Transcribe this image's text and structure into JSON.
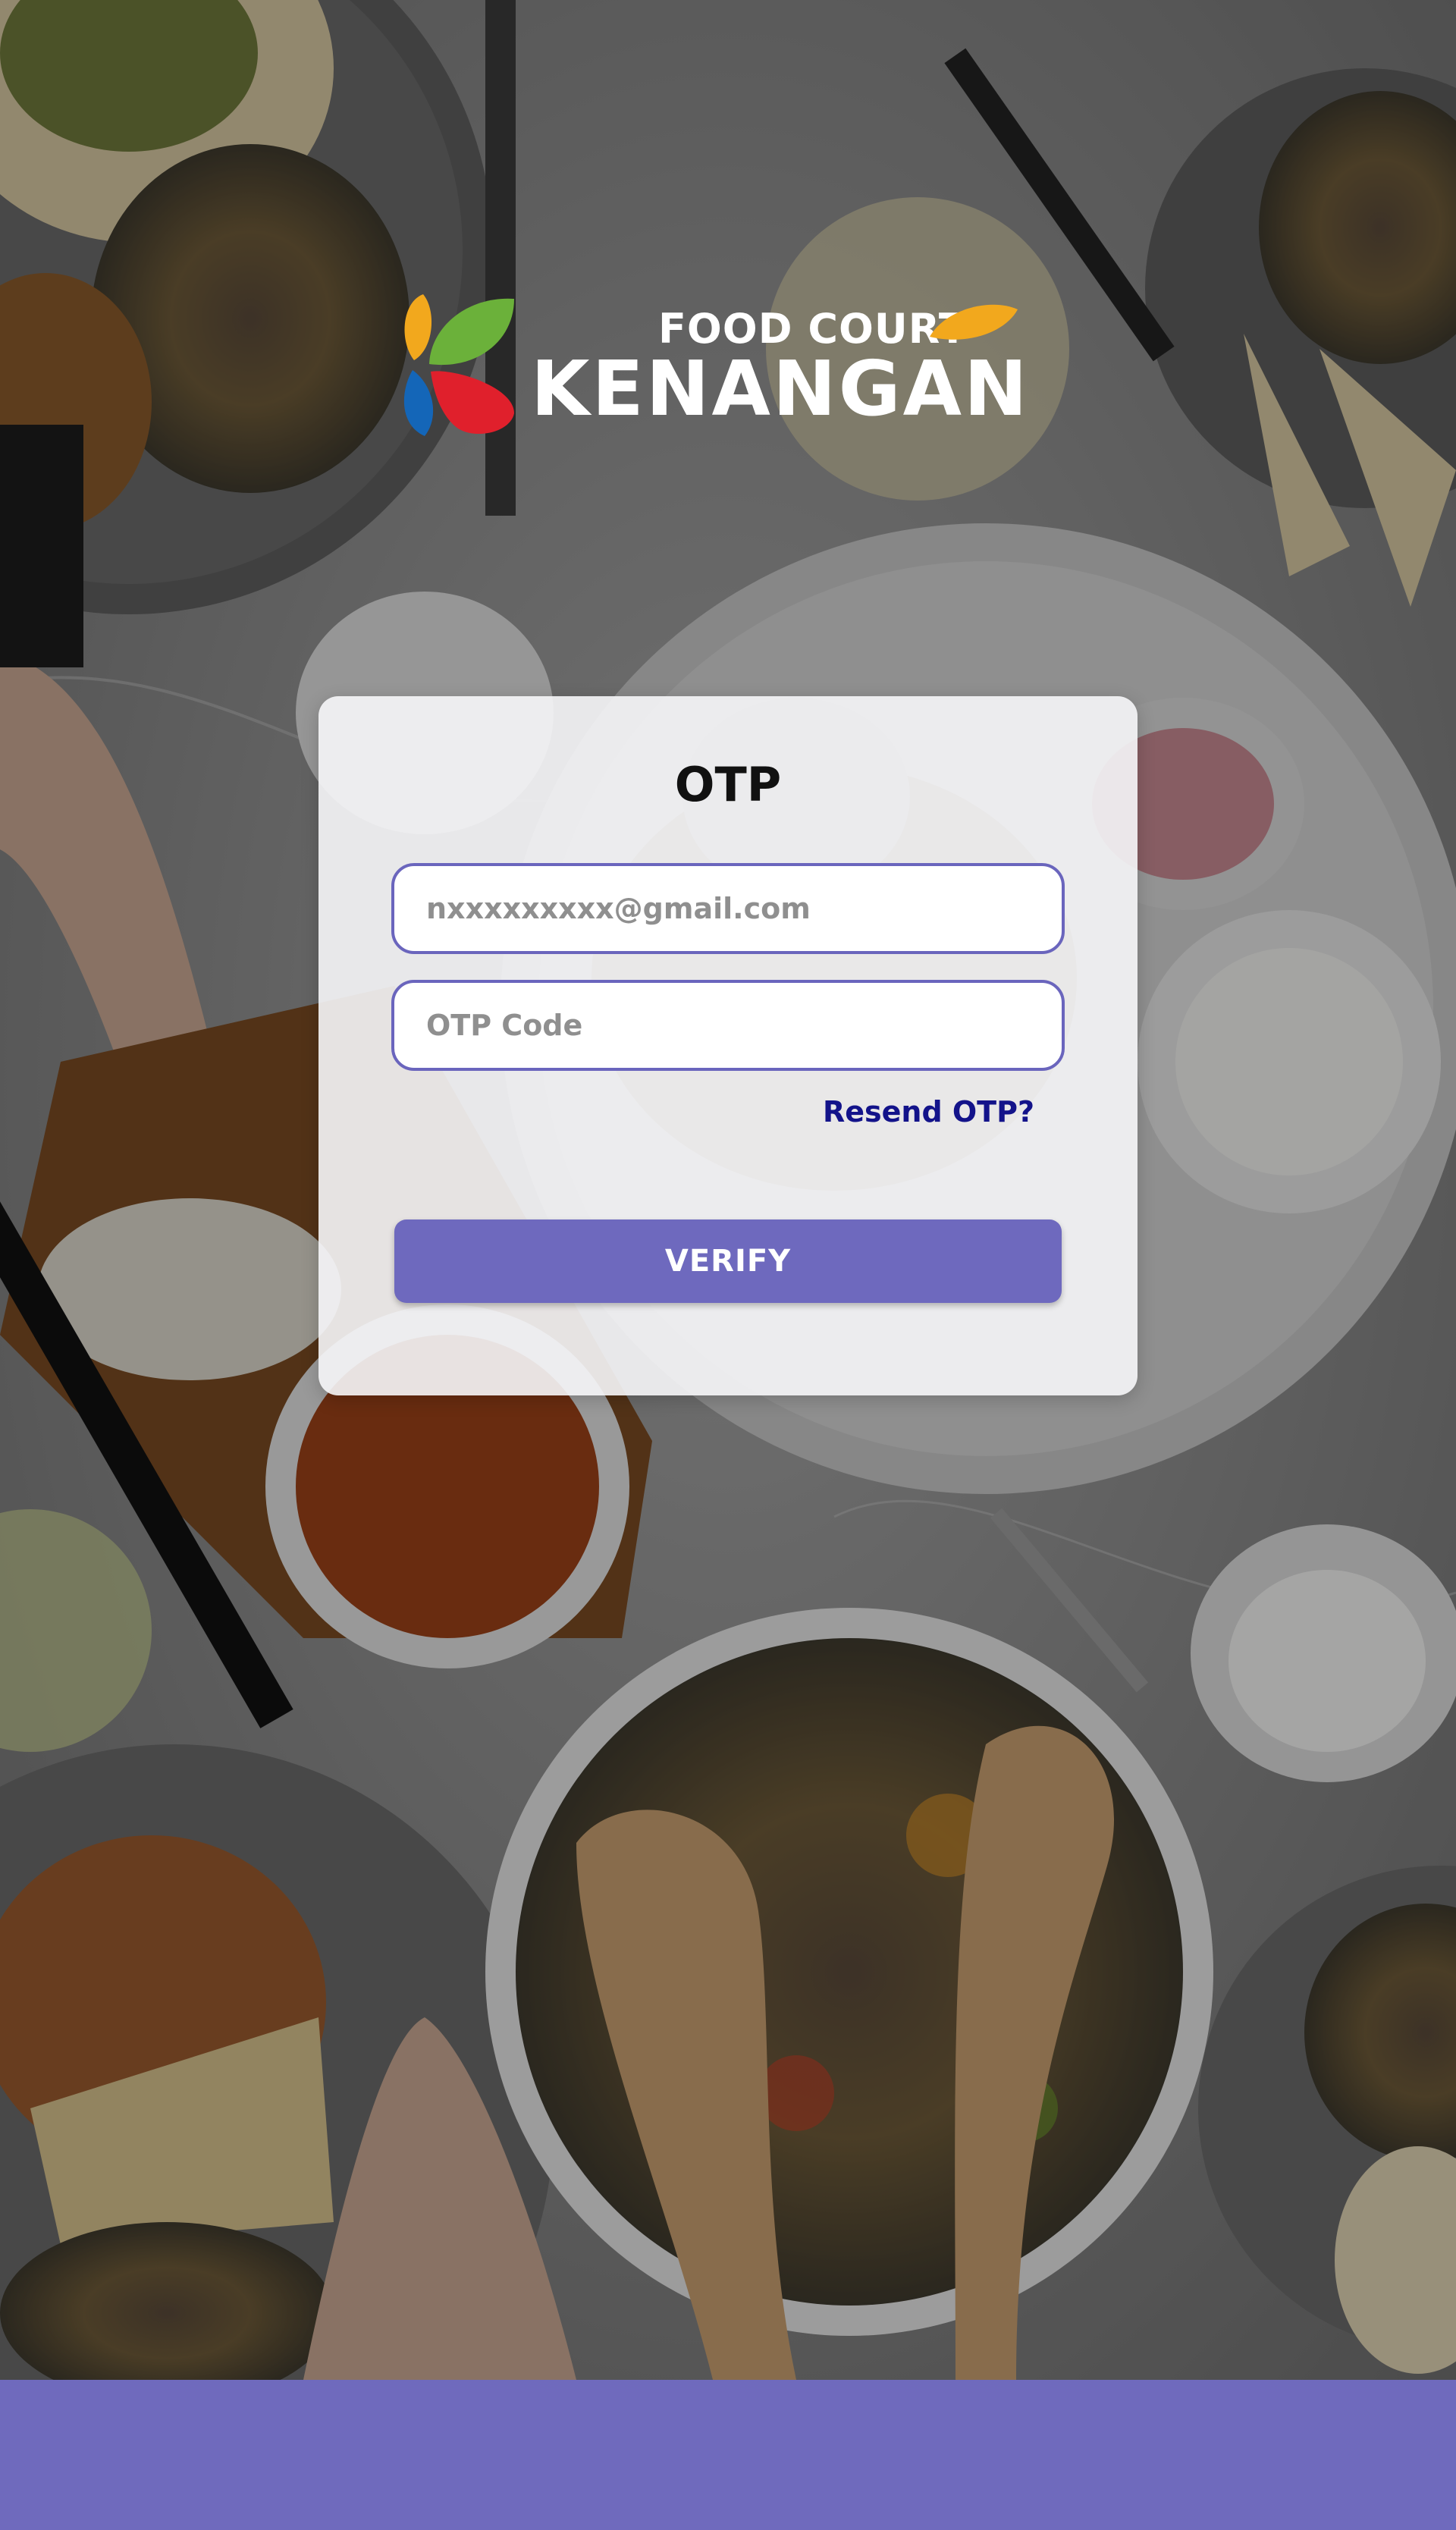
{
  "brand": {
    "top_text": "FOOD COURT",
    "bottom_text": "KENANGAN",
    "logo_icon": "flower-petals-icon",
    "petal_colors": [
      "#f2a81d",
      "#6bb13a",
      "#e0202c",
      "#1466b8"
    ]
  },
  "otp_card": {
    "title": "OTP",
    "email_placeholder": "nxxxxxxxxx@gmail.com",
    "email_value": "",
    "otp_placeholder": "OTP Code",
    "otp_value": "",
    "resend_label": "Resend OTP?",
    "verify_label": "VERIFY"
  },
  "colors": {
    "accent": "#6e69be",
    "link": "#13138a",
    "footer": "#6f6abd"
  }
}
